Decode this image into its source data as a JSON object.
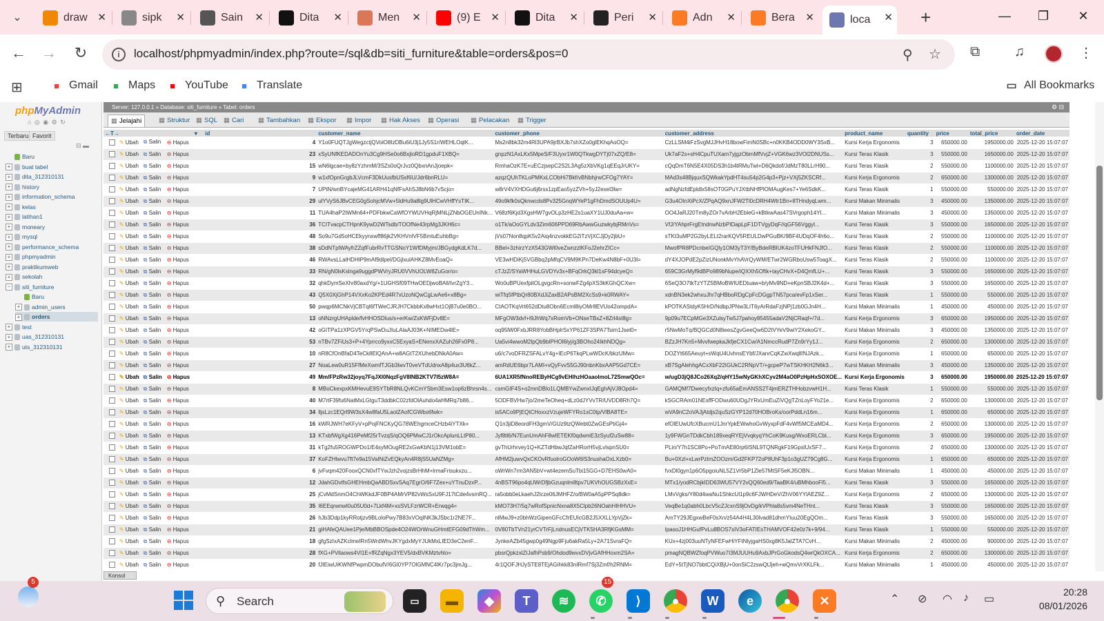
{
  "browser": {
    "tabs": [
      {
        "title": "draw",
        "icon": "drawio-icon",
        "color": "#f08705"
      },
      {
        "title": "sipk",
        "icon": "network-icon",
        "color": "#888888"
      },
      {
        "title": "Sain",
        "icon": "chrome-icon",
        "color": "#555555"
      },
      {
        "title": "Dita",
        "icon": "github-icon",
        "color": "#111111"
      },
      {
        "title": "Men",
        "icon": "claude-icon",
        "color": "#d97757"
      },
      {
        "title": "(9) E",
        "icon": "youtube-icon",
        "color": "#ff0000"
      },
      {
        "title": "Dita",
        "icon": "github-icon",
        "color": "#111111"
      },
      {
        "title": "Peri",
        "icon": "chatgpt-icon",
        "color": "#222222"
      },
      {
        "title": "Adn",
        "icon": "xampp-icon",
        "color": "#fb7a24"
      },
      {
        "title": "Bera",
        "icon": "xampp-icon",
        "color": "#fb7a24"
      },
      {
        "title": "loca",
        "icon": "phpmyadmin-icon",
        "color": "#6c78af",
        "active": true
      }
    ],
    "url": "localhost/phpmyadmin/index.php?route=/sql&db=siti_furniture&table=orders&pos=0",
    "bookmarks": [
      {
        "label": "Gmail",
        "icon": "gmail-icon",
        "color": "#ea4335"
      },
      {
        "label": "Maps",
        "icon": "maps-icon",
        "color": "#34a853"
      },
      {
        "label": "YouTube",
        "icon": "youtube-icon",
        "color": "#ff0000"
      },
      {
        "label": "Translate",
        "icon": "translate-icon",
        "color": "#4285f4"
      }
    ],
    "all_bookmarks": "All Bookmarks"
  },
  "pma": {
    "logo_php": "php",
    "logo_myadmin": "MyAdmin",
    "sidebar_tabs": [
      "Terbaru",
      "Favorit"
    ],
    "tree": [
      {
        "label": "Baru",
        "level": 0,
        "new": true
      },
      {
        "label": "buat tabel",
        "level": 0
      },
      {
        "label": "dita_312310131",
        "level": 0
      },
      {
        "label": "history",
        "level": 0
      },
      {
        "label": "information_schema",
        "level": 0
      },
      {
        "label": "kelas",
        "level": 0
      },
      {
        "label": "latihan1",
        "level": 0
      },
      {
        "label": "moneary",
        "level": 0
      },
      {
        "label": "mysql",
        "level": 0
      },
      {
        "label": "performance_schema",
        "level": 0
      },
      {
        "label": "phpmyadmin",
        "level": 0
      },
      {
        "label": "praktikumweb",
        "level": 0
      },
      {
        "label": "sekolah",
        "level": 0
      },
      {
        "label": "siti_furniture",
        "level": 0,
        "open": true
      },
      {
        "label": "Baru",
        "level": 1,
        "new": true
      },
      {
        "label": "admin_users",
        "level": 1
      },
      {
        "label": "orders",
        "level": 1,
        "selected": true
      },
      {
        "label": "test",
        "level": 0
      },
      {
        "label": "uas_312310131",
        "level": 0
      },
      {
        "label": "uts_312310131",
        "level": 0
      }
    ],
    "breadcrumb": "Server: 127.0.0.1 » Database: siti_furniture » Tabel: orders",
    "tabs": [
      {
        "label": "Jelajahi",
        "icon": "browse-icon",
        "active": true
      },
      {
        "label": "Struktur",
        "icon": "structure-icon"
      },
      {
        "label": "SQL",
        "icon": "sql-icon"
      },
      {
        "label": "Cari",
        "icon": "search-icon"
      },
      {
        "label": "Tambahkan",
        "icon": "insert-icon"
      },
      {
        "label": "Ekspor",
        "icon": "export-icon"
      },
      {
        "label": "Impor",
        "icon": "import-icon"
      },
      {
        "label": "Hak Akses",
        "icon": "privileges-icon"
      },
      {
        "label": "Operasi",
        "icon": "operations-icon"
      },
      {
        "label": "Pelacakan",
        "icon": "tracking-icon"
      },
      {
        "label": "Trigger",
        "icon": "trigger-icon"
      }
    ],
    "columns": [
      "id",
      "customer_name",
      "customer_phone",
      "customer_address",
      "product_name",
      "quantity",
      "price",
      "total_price",
      "order_date"
    ],
    "actions": {
      "edit": "Ubah",
      "copy": "Salin",
      "delete": "Hapus"
    },
    "console": "Konsol",
    "rows": [
      [
        "4",
        "Y1o0FUQTJgWegzctjQVolO8IzDBu6iU3j1Jy5S1r/WEHLOqlK...",
        "Ms2n8bk32m4Rl3UPA9jrBXJb7shXZo0glEKhqAoOQ=",
        "CzLLSM4iFzSvgMJJHvH18bowFimN0SBc+n0KKB4ODD0WY3SxB...",
        "Kursi Kerja Ergonomis",
        "3",
        "650000.00",
        "1950000.00",
        "2025-12-20 15:07:07"
      ],
      [
        "23",
        "xSyUNfKEDADOnYu3Cg9HSe0o6BxjloRD1gpduF1XBQ=",
        "gnpzN1AxLKx5MpeS/F3Uyxr1W0QTkwgDYTj07xZQ/E8=",
        "Uk7aF2s+sH4CpuTUXam7yjgzObmMfVvjZ+VGK6wz3VOl2DNUSs...",
        "Kursi Teras Klasik",
        "3",
        "550000.00",
        "1650000.00",
        "2025-12-20 15:07:07"
      ],
      [
        "15",
        "wN6lgcae+by8zYzhmM/3SZs0oQrJvz0QbxnAnJjoepk=",
        "RmhaOzK7E+uECzjsepC2S2L3Ag5zXbVKg1qEEqJrUKY=",
        "cQqDmT6N5E4X05DS3h1b4tRMuTwl+D6Qkdof/JdMzT80LLrH90...",
        "Kursi Teras Klasik",
        "2",
        "550000.00",
        "1100000.00",
        "2025-12-20 15:07:07"
      ],
      [
        "9",
        "w1xfOpnGrgbJLVcmF3DkUusfbUSsf6U/Jdr6bnRLU=",
        "azqzQUhTKLoPMKxLCObHi7Bkf/vBNbhjrwCFOg7YAY=",
        "MAd3s48BjquxSQWkakYpdHT4su54p2G4p3+Pjz+VXj5ZKSCRf...",
        "Kursi Kerja Ergonomis",
        "2",
        "650000.00",
        "1300000.00",
        "2025-12-20 15:07:07"
      ],
      [
        "7",
        "UPtN/wnBYcajeMG41ARH41qNfFsAhSJ8bN6b7vScjo=",
        "w8rV4VXHDGu6j6rss1zpEao5yzZVh+5yJ2exel3lw=",
        "adNgNzfdEpldlx58sOT0GPuYJXtbNHfPlOMAugKes7+Ye6SdkK...",
        "Kursi Teras Klasik",
        "1",
        "550000.00",
        "550000.00",
        "2025-12-20 15:07:07"
      ],
      [
        "29",
        "ulYVyS6JBvCEG0gSohjcMVw+5ldHu9a8lg9UlHCwVHffYsTIK...",
        "49o9kfk0sQknwcds8Pv325GnqWYeP1gFhDmdSOUUp4U=",
        "G3u4OInXiPcX/ZPqAQ9xnJFW2Tl0cDRH4Wtr1Bn+8THndyqLwm...",
        "Kursi Makan Minimalis",
        "3",
        "450000.00",
        "1350000.00",
        "2025-12-20 15:07:07"
      ],
      [
        "11",
        "TUA4haP2tWMn64+PDFbkwCaWfOYWUVHqRjMNLjZNbOGEUnINk...",
        "V68zf6Kjd3XgsHW7gvOLp3zHE2s1uaXY1UJ0duAa+w=",
        "OO4JaRJ20Tm8yZOr7vArbH2EbleG+kBtkwAas47SVrgoph14YI...",
        "Kursi Makan Minimalis",
        "3",
        "450000.00",
        "1350000.00",
        "2025-12-20 15:07:07"
      ],
      [
        "36",
        "TCITvacpCTHpnK9ywD2WTsdb/TOOfNe43rpMg3JKH6c=",
        "o1Tk/aOoGYLdv3Zim606PPD69RbAwwGuzwkybjRMnVs=",
        "VfJ/YAhprFrgEtndnwNzbPIDapLpF1DTVgyDqF//qGF56Vggyl...",
        "Kursi Teras Klasik",
        "3",
        "550000.00",
        "1650000.00",
        "2025-12-20 15:07:07"
      ],
      [
        "48",
        "So9u7Gd5oHCEkyynxwff86jk2VKHVnlVF5BmtuEuhbBg=",
        "jVs07Non8qpK5v2Aiq4nzvokkEG2iTzVjXCJjDy2jbU=",
        "sTKt3uMP2G2byLELt2rarKQV5REULDwPGuBK/9BF4UDqOF4h6o...",
        "Kursi Teras Klasik",
        "2",
        "550000.00",
        "1100000.00",
        "2025-12-20 15:07:07"
      ],
      [
        "38",
        "sDdNTplWAyfrZZqfFubrRvTTGSNoY1WfDMyjm/JBGydgKdLK7d...",
        "BBel+3zhirzYzX543GWl0veZwnzzlKFoJ2ehrZICc=",
        "MwofPR8PDcnbeIGQly1OM3yT3Y/ByBdeRBIUK4zoTFUHkFNJfO...",
        "Kursi Teras Klasik",
        "2",
        "550000.00",
        "1100000.00",
        "2025-12-20 15:07:07"
      ],
      [
        "46",
        "RWAvsLLalHDHlP9mAf9dlpel/DGjlxulAHKZ8MvEoaQ=",
        "VE3wHDiKj5VGBbq2pMfqCV9M9KPn7DeKw4N8bF+0U3l=",
        "dY4XJOPdE2pZizUNonkMvYhAVrQyWM/ETwr2WGRboUsw5ToagX...",
        "Kursi Teras Klasik",
        "2",
        "550000.00",
        "1100000.00",
        "2025-12-20 15:07:07"
      ],
      [
        "33",
        "RN/gN0lsKslnga9uggdPWVryJRU0VVhUOLW8ZuGor/o=",
        "cTJzZ/SYaWHHuLGVDYv3x+BFqOrkQ3kl1sF94dcyeQ=",
        "659C3GrMyf9dBPo989bNupe/iQXXh5Oftk+tayCHvX+D4QmfLU+...",
        "Kursi Teras Klasik",
        "3",
        "550000.00",
        "1650000.00",
        "2025-12-20 15:07:07"
      ],
      [
        "32",
        "qhkDymSeXhr80axdYg/+1UGHSf09THwOEDjwoBAll/IvrZgY3...",
        "Wo0uBPUexfpitOLgvgcRn+sonwFZg4pXS3kKGhQCXw=",
        "6SeQ3O7tkTzYTZ5BMoBWIUEDtuaw+b/yMv9ND+eKpnSBJ2K4d+...",
        "Kursi Teras Klasik",
        "3",
        "550000.00",
        "1650000.00",
        "2025-12-20 15:07:07"
      ],
      [
        "43",
        "Q5X0XjGhP14VXxKo2KPEd4R7xUzoNQwCgLwAe6+x8Bg=",
        "wiTfq5fPtbQr80BXdJiZaxB2APsBM2XcSs9+k0RWAY=",
        "xdnBN3ek2whxuJhr7qHBboRDgCpFcDGgpTN57pca/evFp1xSer...",
        "Kursi Teras Klasik",
        "1",
        "550000.00",
        "550000.00",
        "2025-12-20 15:07:07"
      ],
      [
        "50",
        "pwqp6MCNkVjCBTql6fTWeCJRJH7CkbbKx8wHxt1OjB7u0e0BO...",
        "CtAOTKqVrt652dDtu8Obn6Ecml8iyOMr8EVUo42ompdA=",
        "kPOTKAStdyK5HrD/NdbpJPNw3LIT6yArRdaFzjNPj1zb0GJn4H...",
        "Kursi Makan Minimalis",
        "1",
        "450000.00",
        "450000.00",
        "2025-12-20 15:07:07"
      ],
      [
        "13",
        "oNNzrgUHAplde/fvHHOSDlus/s+erKw/ZsKWFjDv8E=",
        "MFgOW3dvf+l9JhWq7xRomVb+ONseTBxZ+8Zrl4sI8g=",
        "9p09u7ECpMGe3XZulsyTw5J7pahoy85455adaV2NjCRaqf+/7d...",
        "Kursi Kerja Ergonomis",
        "3",
        "650000.00",
        "1950000.00",
        "2025-12-20 15:07:07"
      ],
      [
        "42",
        "oGITPa1zXPGV5YrqPSwDuJIuLAlaAJ03K+NIMEDw4lE=",
        "oq95lW0FxbJRR8YobBHplrSxYP61ZF3SPA7Tsim1Jsel0=",
        "r5NwMoTq/BQGCd0N8ieesZgvGeeQw6D2tVYeV9wiY2XekoGY...",
        "Kursi Makan Minimalis",
        "3",
        "450000.00",
        "1350000.00",
        "2025-12-20 15:07:07"
      ],
      [
        "53",
        "nTBv7ZFiUs3+P+4Yprrco9yxxC5ExyaS+ENenxXAZuh26Fx0P8...",
        "Ua5vi4wwoM2lpQb9bIPHOl6lyj/g3BOho24IkhNDQg=",
        "BZzJH7Kn5+MvvfwepkaJkfjeCX1Cw/A1NmccRudP7Zn9rYy1J...",
        "Kursi Kerja Ergonomis",
        "2",
        "650000.00",
        "1300000.00",
        "2025-12-20 15:07:07"
      ],
      [
        "10",
        "nR8CfOnBfaD4TeCk8ElQAnA+w8AGtT2XUhebDNkA0Aw=",
        "u6/c7voDFRZSFALvY4g+IEcP6TkqPLwWDcK/bkzUMw=",
        "DOZYt665Aeuyt+sWqU4UvhnsEYbf/JXanrCqKZwXwqlf/NJAzk...",
        "Kursi Kerja Ergonomis",
        "1",
        "650000.00",
        "650000.00",
        "2025-12-20 15:07:07"
      ],
      [
        "27",
        "NoaLew0uR15FfMeXwmfTJGb3lwvT0veVTdUdnxA8p4ux3U6kZ...",
        "amRdUE6bpr7LAMI+vQyFvvS5GJ90nbnKbxAAP5Gd7CE=",
        "xB7SgAlehhgACxXbF22IGUkC2RNpVT/+gcpeP7wTSKHKH2N6k3...",
        "Kursi Makan Minimalis",
        "3",
        "450000.00",
        "1350000.00",
        "2025-12-20 15:07:07"
      ],
      [
        "49",
        "Mm/FPzRw32joyq7FqJXl0NqzFgV8INB2KTV7I5zW8A=",
        "6UA1XR5fNnoREByHCg9vEHlhzHOaaolmoL72SmwQOc=",
        "w/ugD3jQ8JCo26Xq2/qHY15wNyGKhXCyv2M4aO0PzHpHxSOXOE...",
        "Kursi Kerja Ergonomis",
        "3",
        "650000.00",
        "1950000.00",
        "2025-12-20 15:07:07"
      ],
      [
        "8",
        "MBoCkexpxKMHevuE9SYTbR8NLQvKCmYSbm3Esw1op6zBhrsn4s...",
        "csmGIF4S+o2mnDBlo1LQMBYwZwnxIJqEghAjVJ8Opd4=",
        "GAMQMf7DwecyfxzIq+zfu65aEmANSS2T4jmERZTHHobzvwH1H...",
        "Kursi Teras Klasik",
        "1",
        "550000.00",
        "550000.00",
        "2025-12-20 15:07:07"
      ],
      [
        "40",
        "M7rtF39fu6NatMxLGtguT3ddbkC02zfdOlAuhdo4aHMRq7b86...",
        "5ODFBVHw7jo/2meTeOheq+dLz0dJYVvTR/UVDD8Rh7Q=",
        "kSGCRAm01NEsffFODwu60UDgJYRxUmEuZiVQgTZnLoyFYo21e...",
        "Kursi Kerja Ergonomis",
        "2",
        "650000.00",
        "1300000.00",
        "2025-12-20 15:07:07"
      ],
      [
        "34",
        "lljsLzc1EQrl9W3sX4w8faU5LaolZAofCGWbs6fwk=",
        "is5ACo9PjEQtCHoxxzVzujeWFYRo1sC0tp/VlBA8TE=",
        "wVA9nC2oVAJjAtdjs2quSzGYP12d70HOBroKs/oorPddLn16m...",
        "Kursi Kerja Ergonomis",
        "1",
        "650000.00",
        "650000.00",
        "2025-12-20 15:07:07"
      ],
      [
        "16",
        "kWRJWH7eKFyV+pPojFNCKyQG78WEhgmceCHzb4iYTXk=",
        "Q1n3jiD8eordFH3gmV/GUz9tzQWebt0ZwGEsPtiGj4=",
        "efOlEUwUfcXBucmU1JnrYpkEWwhoGvWyxpFdF4vWf5MCEaMD4...",
        "Kursi Kerja Ergonomis",
        "2",
        "650000.00",
        "1300000.00",
        "2025-12-20 15:07:07"
      ],
      [
        "13",
        "KTxbfWgXg416PeMf25rTvzqS/qOQ6PMwCJ1rOkcAplunLLtP80...",
        "Jyf8tl6/N7EunUmAhF8wIETEKf0qdwmE3zSyuf2uSw88=",
        "1y9FWGnTDdkCbh189xeqRYEjVvqkyqYhCoK9Kusg/WxoERLCbl...",
        "Kursi Kerja Ergonomis",
        "3",
        "650000.00",
        "1950000.00",
        "2025-12-20 15:07:07"
      ],
      [
        "31",
        "kTg2fu5ROGWPDo1/E4syMOugRE2xGwKbN1j13VM1obE=",
        "gvThUrhrvey1Q+KZTdHbwJqfZaHRorH5vjLvlspnSU0=",
        "PLin/Y7h1SC8Po+PoTmAE80rp6ISNL9TQNRgkF19GpslUxSF7...",
        "Kursi Kerja Ergonomis",
        "2",
        "650000.00",
        "1300000.00",
        "2025-12-20 15:07:07"
      ],
      [
        "37",
        "KoFZHlwvu7ft7e9a15VaINiZvEQkyAn4R8jS5UaNZMg=",
        "AfHM2juwvQxCKOvRfuolroGOoW6lS3nushaOxLXzb0=",
        "Bu+0Xzl+xLwrPzImZOOzm/Gd2FKP72oP8UhF3p1o3gUZ79Cg8G...",
        "Kursi Kerja Ergonomis",
        "1",
        "650000.00",
        "650000.00",
        "2025-12-20 15:07:07"
      ],
      [
        "6",
        "jvFvqm420FooxQCN0xfTYwJzh2vojzsBrHhM+lrmaFrisukxzu...",
        "oWrWn7rm3AN5bV+wt4ezemSuTbi15GG+D7EHS0wA0=",
        "fvxDl0gyn1p6O5pgoiuNL5Z1Vr5bP1Zle57MtSF5eKJl5OBN...",
        "Kursi Makan Minimalis",
        "1",
        "450000.00",
        "450000.00",
        "2025-12-20 15:07:07"
      ],
      [
        "12",
        "JdahGDvtfsGHEHmbQaABDSxvSAq7EgrO/6F7Zex+uYTnuDzxP...",
        "4nBST96po4qUWrDfjbGzuqnlm8tpv7UKVhOUGSBzXxE=",
        "MTx1/yodRCbjkIDD63WU57VY2vQQ60ed9/TaaBK4/uBMhbooFl5...",
        "Kursi Teras Klasik",
        "3",
        "550000.00",
        "1650000.00",
        "2025-12-20 15:07:07"
      ],
      [
        "25",
        "jCvMdSnmO4ChWKkdJF0BP4AMrVP82vWsSxU9FJ17tCde4vsmRQ...",
        "ra5obb0eLkaehJ2lcze06JMHFZ/o/BW0aA5pPPSq8dk=",
        "LMvVgks/Y80d4waNu1ShkcUl1p9c6FJWHDeV/ZhV06YYlAEZ9Z...",
        "Kursi Kerja Ergonomis",
        "2",
        "650000.00",
        "1300000.00",
        "2025-12-20 15:07:07"
      ],
      [
        "35",
        "I6EEqrwnwI0u05U0d+7Lkf4M+xsSVLFzrWCR+Erwqg4=",
        "kMO73H7/5q7wRofSpnicNxna8X5Clpb26NOahHIHHVU=",
        "VeqBe1q0abh0LbcV5cZJcxnS9jOvDg/kVPhla8s5vm4NeTHnt...",
        "Kursi Teras Klasik",
        "3",
        "550000.00",
        "1650000.00",
        "2025-12-20 15:07:07"
      ],
      [
        "26",
        "hJb3Ddp1kyRRotjzv9BLoloPwy7B83xVOqINK3kJSbc1r2NE7F...",
        "nlMwJ9+z0bhWzGipenGFcCfrEUIcGB2J5XXLLYpVjZk=",
        "AmTY29JEgxwBeF0sXn/z54A4H4L30lvad81dhmYIuu20EgQOm...",
        "Kursi Teras Klasik",
        "3",
        "550000.00",
        "1650000.00",
        "2025-12-20 15:07:07"
      ],
      [
        "21",
        "giHAfeQAUee1Pje/MbBBOSpde4O24WOrWnuGHmtEFG09dThWm...",
        "0V80TbTVn21yrCVTrFjLndnusECjVTK5HA3RfjKGsMM=",
        "IpasoJ1HHGufPvLu8BOS7sIV3oFATIEsTHAMVOF42e0z7k+9/94...",
        "Kursi Teras Klasik",
        "1",
        "550000.00",
        "550000.00",
        "2025-12-20 15:07:07"
      ],
      [
        "18",
        "gfgSzIxAZKclmeIRn5WrdWhvJKYgdxMyYJUkMxLIED3eC2enF...",
        "JynkeAZb45gwp0g49Ngp9Fju6akRa5Ly+2A71SvraFQ=",
        "KUx+4zj003uuNTyNFEFwHiYFtNlyjgaHS0xg8K5JaIZTA7CvH...",
        "Kursi Makan Minimalis",
        "2",
        "450000.00",
        "900000.00",
        "2025-12-20 15:07:07"
      ],
      [
        "28",
        "fXG+PVilaows4Vl1E+fRZqNgx3YEV5/dxBVKMztvhlo=",
        "pbsrQpkzxlZIJafhPsb9/Ohdod9wvxDVjvGAfHHoxm2SA=",
        "pmagNQBWZfoqPVWuo7I3MJUUHu9AxbJPrGoGkodsQ4wrQkOXCA...",
        "Kursi Kerja Ergonomis",
        "2",
        "650000.00",
        "1300000.00",
        "2025-12-20 15:07:07"
      ],
      [
        "20",
        "fJIEiwUiKWNfPwpmDObufV/6GI0YP7OlGMNC4lKr7pc3jmJg...",
        "4r1QOFJHJySTE8TEjAGihkk83nIRmf7Sj3Zmf/h2RNM=",
        "EdY+5tTjNO7bbtCQiXBjU+0onSiC2zswQtJjeh+wQmvVrXKLFk...",
        "Kursi Makan Minimalis",
        "1",
        "450000.00",
        "450000.00",
        "2025-12-20 15:07:07"
      ]
    ]
  },
  "taskbar": {
    "search_label": "Search",
    "weather_badge": "5",
    "whatsapp_badge": "15",
    "time": "20:28",
    "date": "08/01/2026"
  }
}
